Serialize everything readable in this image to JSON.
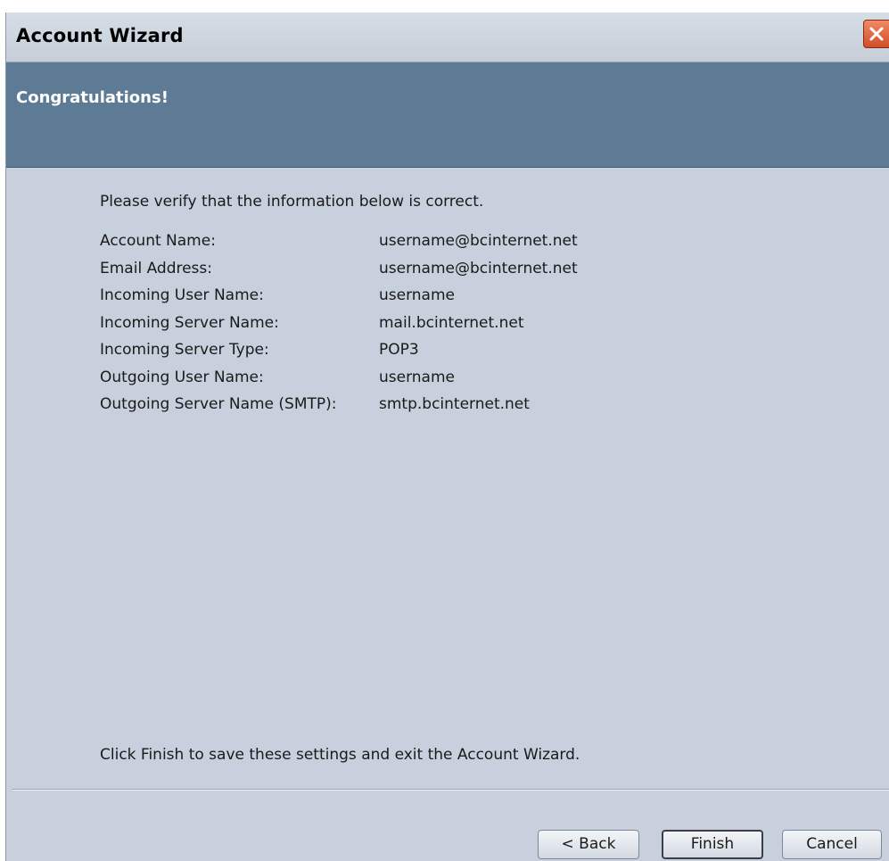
{
  "window": {
    "title": "Account Wizard"
  },
  "banner": {
    "title": "Congratulations!"
  },
  "content": {
    "intro": "Please verify that the information below is correct.",
    "rows": [
      {
        "label": "Account Name:",
        "value": "username@bcinternet.net"
      },
      {
        "label": "Email Address:",
        "value": "username@bcinternet.net"
      },
      {
        "label": "Incoming User Name:",
        "value": "username"
      },
      {
        "label": "Incoming Server Name:",
        "value": "mail.bcinternet.net"
      },
      {
        "label": "Incoming Server Type:",
        "value": "POP3"
      },
      {
        "label": "Outgoing User Name:",
        "value": "username"
      },
      {
        "label": "Outgoing Server Name (SMTP):",
        "value": "smtp.bcinternet.net"
      }
    ],
    "outro": "Click Finish to save these settings and exit the Account Wizard."
  },
  "buttons": {
    "back": "< Back",
    "finish": "Finish",
    "cancel": "Cancel"
  },
  "colors": {
    "banner": "#5d7b95",
    "body": "#c7d0dc",
    "close": "#d24e28"
  },
  "icons": {
    "close": "close-icon"
  }
}
